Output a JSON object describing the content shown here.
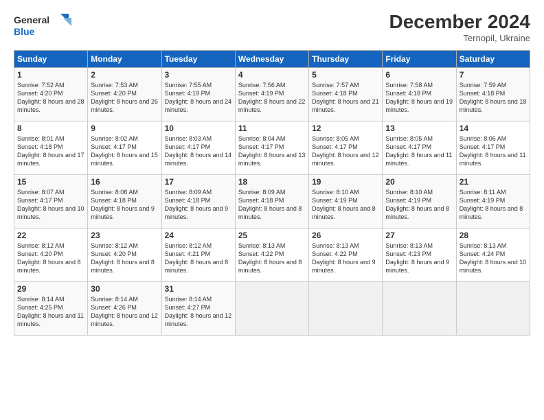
{
  "logo": {
    "line1": "General",
    "line2": "Blue"
  },
  "title": "December 2024",
  "subtitle": "Ternopil, Ukraine",
  "headers": [
    "Sunday",
    "Monday",
    "Tuesday",
    "Wednesday",
    "Thursday",
    "Friday",
    "Saturday"
  ],
  "weeks": [
    [
      {
        "day": "1",
        "sunrise": "7:52 AM",
        "sunset": "4:20 PM",
        "daylight": "8 hours and 28 minutes."
      },
      {
        "day": "2",
        "sunrise": "7:53 AM",
        "sunset": "4:20 PM",
        "daylight": "8 hours and 26 minutes."
      },
      {
        "day": "3",
        "sunrise": "7:55 AM",
        "sunset": "4:19 PM",
        "daylight": "8 hours and 24 minutes."
      },
      {
        "day": "4",
        "sunrise": "7:56 AM",
        "sunset": "4:19 PM",
        "daylight": "8 hours and 22 minutes."
      },
      {
        "day": "5",
        "sunrise": "7:57 AM",
        "sunset": "4:18 PM",
        "daylight": "8 hours and 21 minutes."
      },
      {
        "day": "6",
        "sunrise": "7:58 AM",
        "sunset": "4:18 PM",
        "daylight": "8 hours and 19 minutes."
      },
      {
        "day": "7",
        "sunrise": "7:59 AM",
        "sunset": "4:18 PM",
        "daylight": "8 hours and 18 minutes."
      }
    ],
    [
      {
        "day": "8",
        "sunrise": "8:01 AM",
        "sunset": "4:18 PM",
        "daylight": "8 hours and 17 minutes."
      },
      {
        "day": "9",
        "sunrise": "8:02 AM",
        "sunset": "4:17 PM",
        "daylight": "8 hours and 15 minutes."
      },
      {
        "day": "10",
        "sunrise": "8:03 AM",
        "sunset": "4:17 PM",
        "daylight": "8 hours and 14 minutes."
      },
      {
        "day": "11",
        "sunrise": "8:04 AM",
        "sunset": "4:17 PM",
        "daylight": "8 hours and 13 minutes."
      },
      {
        "day": "12",
        "sunrise": "8:05 AM",
        "sunset": "4:17 PM",
        "daylight": "8 hours and 12 minutes."
      },
      {
        "day": "13",
        "sunrise": "8:05 AM",
        "sunset": "4:17 PM",
        "daylight": "8 hours and 11 minutes."
      },
      {
        "day": "14",
        "sunrise": "8:06 AM",
        "sunset": "4:17 PM",
        "daylight": "8 hours and 11 minutes."
      }
    ],
    [
      {
        "day": "15",
        "sunrise": "8:07 AM",
        "sunset": "4:17 PM",
        "daylight": "8 hours and 10 minutes."
      },
      {
        "day": "16",
        "sunrise": "8:08 AM",
        "sunset": "4:18 PM",
        "daylight": "8 hours and 9 minutes."
      },
      {
        "day": "17",
        "sunrise": "8:09 AM",
        "sunset": "4:18 PM",
        "daylight": "8 hours and 9 minutes."
      },
      {
        "day": "18",
        "sunrise": "8:09 AM",
        "sunset": "4:18 PM",
        "daylight": "8 hours and 8 minutes."
      },
      {
        "day": "19",
        "sunrise": "8:10 AM",
        "sunset": "4:19 PM",
        "daylight": "8 hours and 8 minutes."
      },
      {
        "day": "20",
        "sunrise": "8:10 AM",
        "sunset": "4:19 PM",
        "daylight": "8 hours and 8 minutes."
      },
      {
        "day": "21",
        "sunrise": "8:11 AM",
        "sunset": "4:19 PM",
        "daylight": "8 hours and 8 minutes."
      }
    ],
    [
      {
        "day": "22",
        "sunrise": "8:12 AM",
        "sunset": "4:20 PM",
        "daylight": "8 hours and 8 minutes."
      },
      {
        "day": "23",
        "sunrise": "8:12 AM",
        "sunset": "4:20 PM",
        "daylight": "8 hours and 8 minutes."
      },
      {
        "day": "24",
        "sunrise": "8:12 AM",
        "sunset": "4:21 PM",
        "daylight": "8 hours and 8 minutes."
      },
      {
        "day": "25",
        "sunrise": "8:13 AM",
        "sunset": "4:22 PM",
        "daylight": "8 hours and 8 minutes."
      },
      {
        "day": "26",
        "sunrise": "8:13 AM",
        "sunset": "4:22 PM",
        "daylight": "8 hours and 9 minutes."
      },
      {
        "day": "27",
        "sunrise": "8:13 AM",
        "sunset": "4:23 PM",
        "daylight": "8 hours and 9 minutes."
      },
      {
        "day": "28",
        "sunrise": "8:13 AM",
        "sunset": "4:24 PM",
        "daylight": "8 hours and 10 minutes."
      }
    ],
    [
      {
        "day": "29",
        "sunrise": "8:14 AM",
        "sunset": "4:25 PM",
        "daylight": "8 hours and 11 minutes."
      },
      {
        "day": "30",
        "sunrise": "8:14 AM",
        "sunset": "4:26 PM",
        "daylight": "8 hours and 12 minutes."
      },
      {
        "day": "31",
        "sunrise": "8:14 AM",
        "sunset": "4:27 PM",
        "daylight": "8 hours and 12 minutes."
      },
      null,
      null,
      null,
      null
    ]
  ],
  "labels": {
    "sunrise": "Sunrise:",
    "sunset": "Sunset:",
    "daylight": "Daylight:"
  }
}
